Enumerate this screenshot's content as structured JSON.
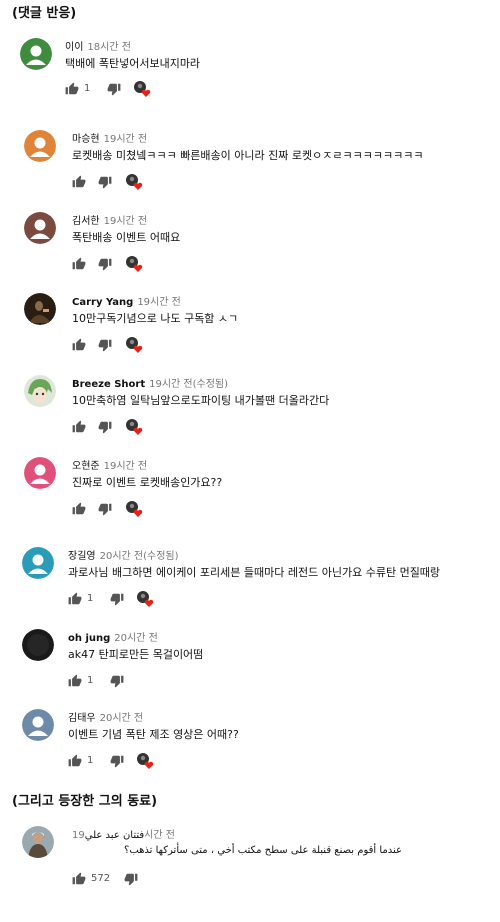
{
  "sections": {
    "reactions_title": "(댓글 반응)",
    "colleague_title": "(그리고 등장한 그의 동료)"
  },
  "colors": {
    "heart": "#e62117",
    "icon_gray": "#555555"
  },
  "comments": [
    {
      "author": "이이",
      "time": "18시간 전",
      "text": "택배에 폭탄넣어서보내지마라",
      "likes": "1",
      "avatar_color": "#3f8c3f",
      "avatar": "default"
    },
    {
      "author": "마승현",
      "time": "19시간 전",
      "text": "로켓배송 미쳤넼ㅋㅋㅋ 빠른배송이 아니라 진짜 로켓ㅇㅈㄹㅋㅋㅋㅋㅋㅋㅋㅋ",
      "likes": "",
      "avatar_color": "#e0843a",
      "avatar": "default"
    },
    {
      "author": "김서한",
      "time": "19시간 전",
      "text": "폭탄배송 이벤트 어때요",
      "likes": "",
      "avatar_color": "#7a4a3e",
      "avatar": "default"
    },
    {
      "author": "Carry Yang",
      "time": "19시간 전",
      "text": "10만구독기념으로 나도 구독함 ㅅㄱ",
      "likes": "",
      "avatar_color": "#3a2a1a",
      "avatar": "photo"
    },
    {
      "author": "Breeze Short",
      "time": "19시간 전(수정됨)",
      "text": "10만축하염 일탁님앞으로도파이팅 내가볼땐 더올라간다",
      "likes": "",
      "avatar_color": "#7ab06a",
      "avatar": "anime"
    },
    {
      "author": "오현준",
      "time": "19시간 전",
      "text": "진짜로 이벤트 로켓배송인가요??",
      "likes": "",
      "avatar_color": "#e0507a",
      "avatar": "default"
    },
    {
      "author": "장길영",
      "time": "20시간 전(수정됨)",
      "text": "과로사님 배그하면 에이케이 포리세븐 들때마다 레전드 아닌가요 수류탄 먼질때랑",
      "likes": "1",
      "avatar_color": "#2a9bb8",
      "avatar": "default"
    },
    {
      "author": "oh jung",
      "time": "20시간 전",
      "text": "ak47 탄피로만든 목걸이어떰",
      "likes": "1",
      "avatar_color": "#1a1a1a",
      "avatar": "dark"
    },
    {
      "author": "김태우",
      "time": "20시간 전",
      "text": "이벤트 기념 폭탄 제조 영상은 어때??",
      "likes": "1",
      "avatar_color": "#6d8aa8",
      "avatar": "default"
    }
  ],
  "colleague": {
    "author": "فتتان عبد علي",
    "time": "19시간 전",
    "text": "عندما أقوم بصنع قنبلة على سطح مكتب أخي ، متى سأتركها تذهب؟",
    "likes": "572"
  }
}
